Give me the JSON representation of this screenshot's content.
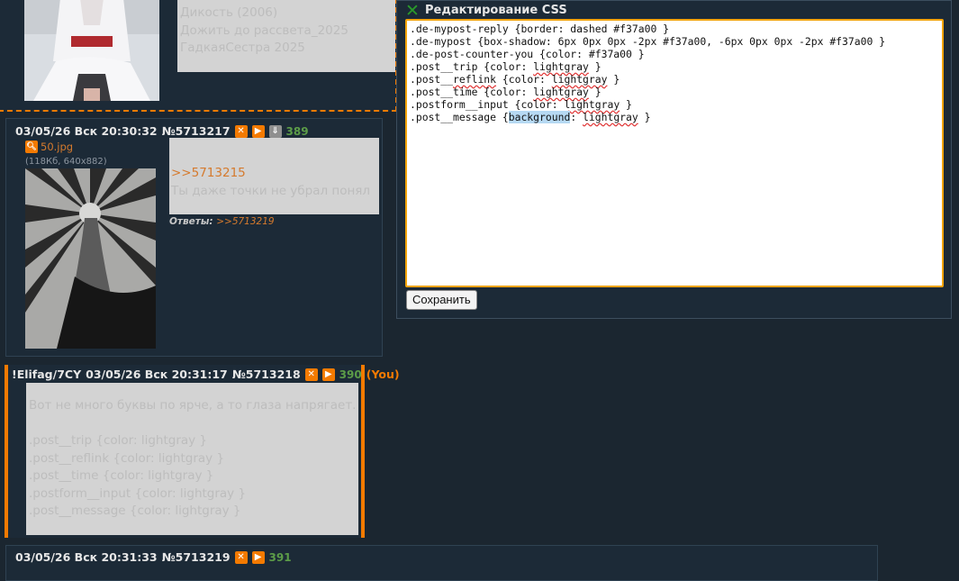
{
  "colors": {
    "accent": "#f37a00",
    "background": "#1b2630",
    "post_bg": "#1c2a37",
    "counter": "#5c9c48"
  },
  "top_post": {
    "lines": [
      "Дикость (2006)",
      "Дожить до рассвета_2025",
      "ГадкаяСестра 2025"
    ]
  },
  "post1": {
    "date": "03/05/26 Вск 20:30:32",
    "number": "№5713217",
    "counter": "389",
    "file_name": "50.jpg",
    "file_meta": "(118Кб, 640x882)",
    "reply_link": ">>5713215",
    "text": "Ты даже точки не убрал понял",
    "answers_label": "Ответы:",
    "answers_link": ">>5713219"
  },
  "post2": {
    "trip": "!Elifag/7CY",
    "date": "03/05/26 Вск 20:31:17",
    "number": "№5713218",
    "counter": "390",
    "you": "(You)",
    "lines": [
      "Вот не много буквы по ярче, а то глаза напрягает.",
      "",
      ".post__trip {color: lightgray }",
      ".post__reflink {color: lightgray }",
      ".post__time {color: lightgray }",
      ".postform__input {color: lightgray }",
      ".post__message {color: lightgray }"
    ]
  },
  "post3": {
    "date": "03/05/26 Вск 20:31:33",
    "number": "№5713219",
    "counter": "391"
  },
  "css_panel": {
    "title": "Редактирование CSS",
    "save_label": "Сохранить",
    "code": {
      "l1": ".de-mypost-reply {border: dashed #f37a00 }",
      "l2": ".de-mypost {box-shadow: 6px 0px 0px -2px #f37a00, -6px 0px 0px -2px #f37a00 }",
      "l3": ".de-post-counter-you {color: #f37a00 }",
      "l4a": ".post__trip {color: ",
      "l4b": "lightgray",
      "l4c": " }",
      "l5a": ".post__",
      "l5b": "reflink",
      "l5c": " {color: ",
      "l5d": "lightgray",
      "l5e": " }",
      "l6a": ".post__time {color: ",
      "l6b": "lightgray",
      "l6c": " }",
      "l7a": ".postform__input {color: ",
      "l7b": "lightgray",
      "l7c": " }",
      "l8a": ".post__message {",
      "l8b": "background",
      "l8c": ": ",
      "l8d": "lightgray",
      "l8e": " }"
    }
  }
}
